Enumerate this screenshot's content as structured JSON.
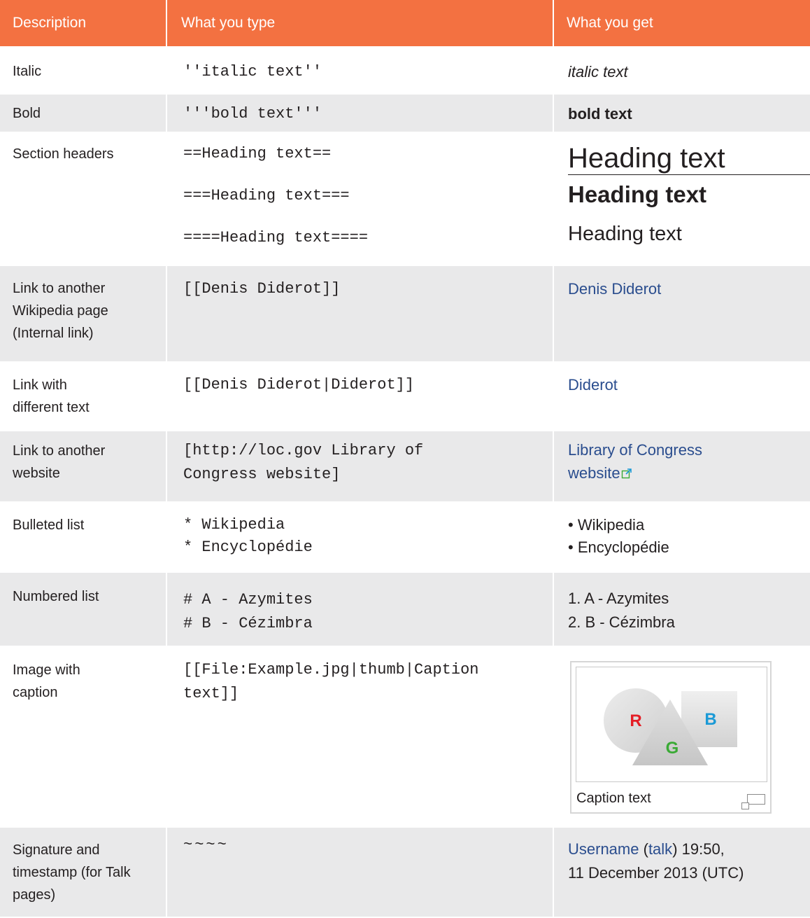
{
  "headers": {
    "description": "Description",
    "what_you_type": "What you type",
    "what_you_get": "What you get"
  },
  "rows": {
    "italic": {
      "description": "Italic",
      "type": "''italic text''",
      "get": "italic text"
    },
    "bold": {
      "description": "Bold",
      "type": "'''bold text'''",
      "get": "bold text"
    },
    "headers": {
      "description": "Section headers",
      "type": [
        "==Heading text==",
        "===Heading text===",
        "====Heading text===="
      ],
      "get": [
        "Heading text",
        "Heading text",
        "Heading text"
      ]
    },
    "internal_link": {
      "description": [
        "Link to another",
        "Wikipedia page",
        "(Internal link)"
      ],
      "type": "[[Denis Diderot]]",
      "get": "Denis Diderot"
    },
    "piped_link": {
      "description": [
        "Link with",
        "different text"
      ],
      "type": "[[Denis Diderot|Diderot]]",
      "get": "Diderot"
    },
    "external_link": {
      "description": [
        "Link to another",
        "website"
      ],
      "type": [
        "[http://loc.gov Library of",
        "Congress website]"
      ],
      "get": [
        "Library of Congress",
        "website"
      ]
    },
    "bulleted": {
      "description": "Bulleted list",
      "type": [
        "* Wikipedia",
        "* Encyclopédie"
      ],
      "get": [
        "• Wikipedia",
        "• Encyclopédie"
      ]
    },
    "numbered": {
      "description": "Numbered list",
      "type": [
        "# A - Azymites",
        "# B - Cézimbra"
      ],
      "get": [
        "1. A - Azymites",
        "2. B - Cézimbra"
      ]
    },
    "image": {
      "description": [
        "Image with",
        "caption"
      ],
      "type": [
        "[[File:Example.jpg|thumb|Caption",
        "text]]"
      ],
      "caption": "Caption text",
      "letters": {
        "r": "R",
        "g": "G",
        "b": "B"
      }
    },
    "signature": {
      "description": [
        "Signature and",
        "timestamp (for Talk",
        "pages)"
      ],
      "type": "~~~~",
      "get_user": "Username",
      "get_open": " (",
      "get_talk": "talk",
      "get_close": ") 19:50,",
      "get_line2": "11 December 2013 (UTC)"
    }
  },
  "colors": {
    "header_bg": "#f37141",
    "alt_row_bg": "#e9e9ea",
    "link": "#2a4d8e",
    "red": "#e41e26",
    "green": "#3aaa35",
    "blue": "#1b9ad6"
  }
}
